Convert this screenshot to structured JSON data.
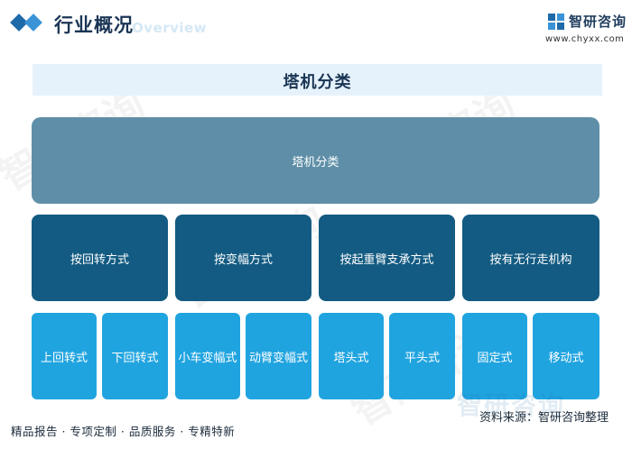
{
  "header": {
    "title": "行业概况",
    "subtitle": "Overview",
    "brand": "智研咨询",
    "url": "www.chyxx.com"
  },
  "band": {
    "title": "塔机分类"
  },
  "root": {
    "label": "塔机分类"
  },
  "categories": [
    {
      "label": "按回转方式"
    },
    {
      "label": "按变幅方式"
    },
    {
      "label": "按起重臂支承方式"
    },
    {
      "label": "按有无行走机构"
    }
  ],
  "leaves": [
    {
      "label": "上回转式"
    },
    {
      "label": "下回转式"
    },
    {
      "label": "小车变幅式"
    },
    {
      "label": "动臂变幅式"
    },
    {
      "label": "塔头式"
    },
    {
      "label": "平头式"
    },
    {
      "label": "固定式"
    },
    {
      "label": "移动式"
    }
  ],
  "footer": {
    "left": "精品报告 · 专项定制 · 品质服务 · 专精特新",
    "source": "资料来源：智研咨询整理",
    "watermark_brand": "智研咨询"
  },
  "colors": {
    "root": "#5f8fa8",
    "category": "#135b82",
    "leaf": "#20a4e0",
    "band": "#e6f2fb",
    "accent": "#1e6aa8"
  },
  "icons": [
    "diamond-bullet-icon",
    "brand-logo-icon"
  ]
}
